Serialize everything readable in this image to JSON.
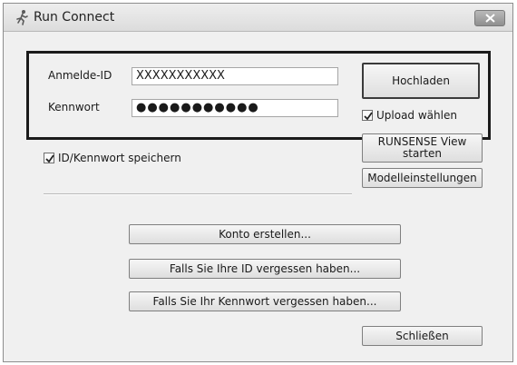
{
  "window": {
    "title": "Run Connect"
  },
  "login": {
    "id_label": "Anmelde-ID",
    "id_value": "XXXXXXXXXXX",
    "password_label": "Kennwort",
    "password_value": "●●●●●●●●●●●"
  },
  "buttons": {
    "upload": "Hochladen",
    "runsense_view": "RUNSENSE View starten",
    "model_settings": "Modelleinstellungen",
    "create_account": "Konto erstellen...",
    "forgot_id": "Falls Sie Ihre ID vergessen haben...",
    "forgot_password": "Falls Sie Ihr Kennwort vergessen haben...",
    "close": "Schließen"
  },
  "checkboxes": {
    "select_upload": {
      "label": "Upload wählen",
      "checked": true
    },
    "save_credentials": {
      "label": "ID/Kennwort speichern",
      "checked": true
    }
  },
  "icons": {
    "app": "runner-icon",
    "close": "close-icon",
    "check": "checkmark-icon"
  }
}
